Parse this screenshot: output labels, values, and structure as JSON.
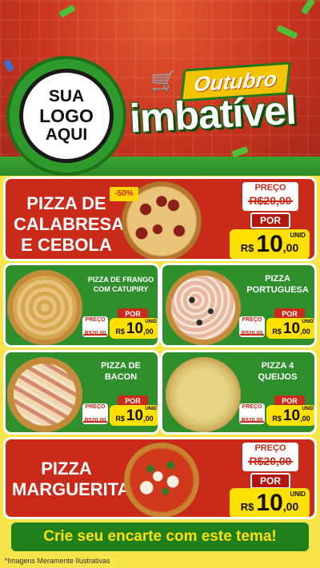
{
  "header": {
    "logo_lines": [
      "SUA",
      "LOGO",
      "AQUI"
    ],
    "promo_top": "Outubro",
    "promo_main": "imbatível"
  },
  "featured_1": {
    "name_lines": [
      "PIZZA DE",
      "CALABRESA",
      "E CEBOLA"
    ],
    "discount": "-50%",
    "preco_label": "PREÇO",
    "old_price": "R$20,00",
    "por_label": "POR",
    "currency": "R$",
    "price_int": "10",
    "price_dec": ",00",
    "unit": "UNID"
  },
  "grid": [
    {
      "name_lines": [
        "PIZZA DE FRANGO",
        "COM CATUPIRY"
      ],
      "preco_label": "PREÇO",
      "old_price": "R$20,00",
      "por_label": "POR",
      "currency": "R$",
      "price_int": "10",
      "price_dec": ",00",
      "unit": "UNID"
    },
    {
      "name_lines": [
        "PIZZA",
        "PORTUGUESA"
      ],
      "preco_label": "PREÇO",
      "old_price": "R$20,00",
      "por_label": "POR",
      "currency": "R$",
      "price_int": "10",
      "price_dec": ",00",
      "unit": "UNID"
    },
    {
      "name_lines": [
        "PIZZA DE",
        "BACON"
      ],
      "preco_label": "PREÇO",
      "old_price": "R$20,00",
      "por_label": "POR",
      "currency": "R$",
      "price_int": "10",
      "price_dec": ",00",
      "unit": "UNID"
    },
    {
      "name_lines": [
        "PIZZA 4",
        "QUEIJOS"
      ],
      "preco_label": "PREÇO",
      "old_price": "R$20,00",
      "por_label": "POR",
      "currency": "R$",
      "price_int": "10",
      "price_dec": ",00",
      "unit": "UNID"
    }
  ],
  "featured_2": {
    "name_lines": [
      "PIZZA",
      "MARGUERITA"
    ],
    "preco_label": "PREÇO",
    "old_price": "R$20,00",
    "por_label": "POR",
    "currency": "R$",
    "price_int": "10",
    "price_dec": ",00",
    "unit": "UNID"
  },
  "footer": {
    "cta": "Crie seu encarte com este tema!",
    "disclaimer": "*Imagens Meramente Ilustrativas"
  },
  "colors": {
    "red": "#c92a1a",
    "green": "#2f8f2d",
    "yellow": "#ffe000",
    "background": "#f7e34a"
  }
}
